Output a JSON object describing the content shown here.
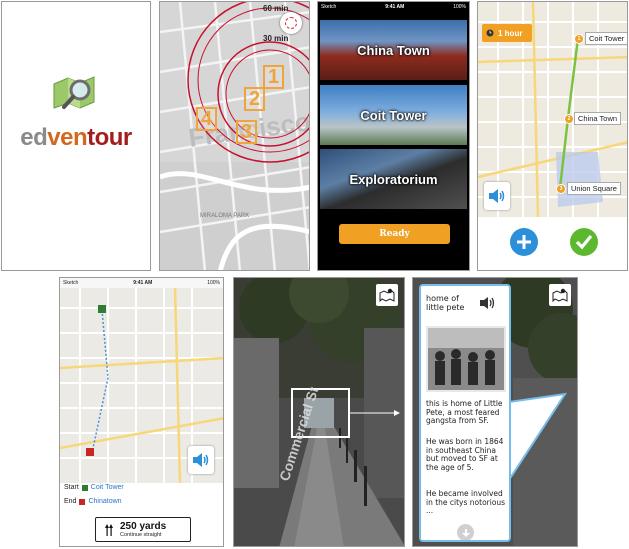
{
  "screens": {
    "splash": {
      "logo_ed": "ed",
      "logo_ven": "ven",
      "logo_tour": "tour"
    },
    "radius_map": {
      "label_60": "60 min",
      "label_30": "30 min",
      "numbers": [
        "1",
        "2",
        "3",
        "4"
      ]
    },
    "places": {
      "status_carrier": "Sketch",
      "status_time": "9:41 AM",
      "status_battery": "100%",
      "items": [
        "China Town",
        "Coit Tower",
        "Exploratorium"
      ],
      "ready_label": "Ready"
    },
    "route": {
      "hour_label": "1 hour",
      "stops": [
        {
          "num": "1",
          "label": "Coit Tower"
        },
        {
          "num": "2",
          "label": "China Town"
        },
        {
          "num": "3",
          "label": "Union Square"
        }
      ]
    },
    "navigation": {
      "status_carrier": "Sketch",
      "status_time": "9:41 AM",
      "status_battery": "100%",
      "start_label": "Start",
      "start_value": "Coit Tower",
      "end_label": "End",
      "end_value": "Chinatown",
      "distance": "250 yards",
      "instruction": "Continue straight"
    },
    "street_view": {
      "street_name": "Commercial St"
    },
    "info": {
      "title": "home of little pete",
      "p1": "this is home of Little Pete, a most feared gangsta from SF.",
      "p2": "He was born in 1864 in southeast China but moved to SF at the age of 5.",
      "p3": "He became involved in the citys notorious ..."
    }
  },
  "colors": {
    "orange": "#f0a023",
    "red_ring": "#c8102e",
    "blue_panel": "#76bde8",
    "route_green": "#7cc242",
    "check_green": "#5cb82f",
    "plus_blue": "#2b8fd9"
  },
  "icons": [
    "magnifier-map-icon",
    "target-icon",
    "hour-clock-icon",
    "speaker-icon",
    "plus-icon",
    "check-icon",
    "map-toggle-icon",
    "straight-arrow-icon",
    "down-arrow-icon"
  ]
}
